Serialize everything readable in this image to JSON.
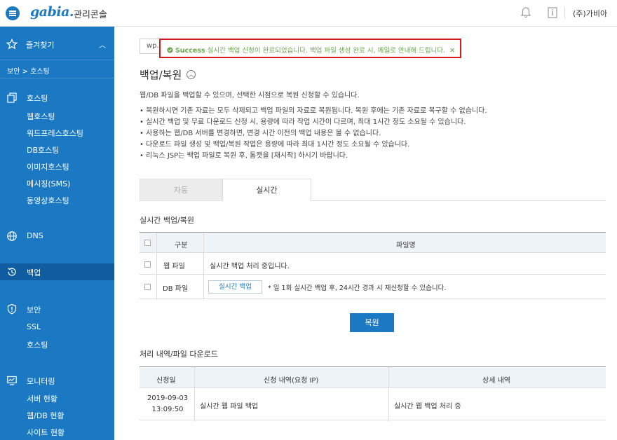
{
  "header": {
    "logo": "gabia.",
    "console_title": "관리콘솔",
    "user": "(주)가비아"
  },
  "sidebar": {
    "favorites": "즐겨찾기",
    "breadcrumb": "보안 > 호스팅",
    "hosting": {
      "title": "호스팅",
      "items": [
        "웹호스팅",
        "워드프레스호스팅",
        "DB호스팅",
        "이미지호스팅",
        "메시징(SMS)",
        "동영상호스팅"
      ]
    },
    "dns": "DNS",
    "backup": "백업",
    "security": {
      "title": "보안",
      "items": [
        "SSL",
        "호스팅"
      ]
    },
    "monitoring": {
      "title": "모니터링",
      "items": [
        "서버 현황",
        "웹/DB 현황",
        "사이트 현황"
      ]
    }
  },
  "main": {
    "domain_select": "wp.g",
    "alert": {
      "status": "Success",
      "message": "실시간 백업 신청이 완료되었습니다. 백업 파일 생성 완료 시, 메일로 안내해 드립니다.",
      "close": "✕"
    },
    "title": "백업/복원",
    "description": "웹/DB 파일을 백업할 수 있으며, 선택한 시점으로 복원 신청할 수 있습니다.",
    "notes": [
      "복원하시면 기존 자료는 모두 삭제되고 백업 파일의 자료로 복원됩니다. 복원 후에는 기존 자료로 복구할 수 없습니다.",
      "실시간 백업 및 무료 다운로드 신청 시, 용량에 따라 작업 시간이 다르며, 최대 1시간 정도 소요될 수 있습니다.",
      "사용하는 웹/DB 서버를 변경하면, 변경 시간 이전의 백업 내용은 볼 수 없습니다.",
      "다운로드 파일 생성 및 백업/복원 작업은 용량에 따라 최대 1시간 정도 소요될 수 있습니다.",
      "리눅스 JSP는 백업 파일로 복원 후, 톰캣을 [재시작] 하시기 바랍니다."
    ],
    "tabs": [
      "자동",
      "실시간"
    ],
    "realtime_section": "실시간 백업/복원",
    "backup_table": {
      "headers": [
        "구분",
        "파일명"
      ],
      "rows": [
        {
          "type": "웹 파일",
          "content": "실시간 백업 처리 중입니다."
        },
        {
          "type": "DB 파일",
          "button": "실시간 백업",
          "content": "* 일 1회 실시간 백업 후, 24시간 경과 시 재신청할 수 있습니다."
        }
      ]
    },
    "restore_button": "복원",
    "history_section": "처리 내역/파일 다운로드",
    "history_table": {
      "headers": [
        "신청일",
        "신청 내역(요청 IP)",
        "상세 내역"
      ],
      "rows": [
        {
          "date": "2019-09-03",
          "time": "13:09:50",
          "request": "실시간 웹 파일 백업",
          "detail": "실시간 웹 백업 처리 중"
        }
      ]
    }
  }
}
